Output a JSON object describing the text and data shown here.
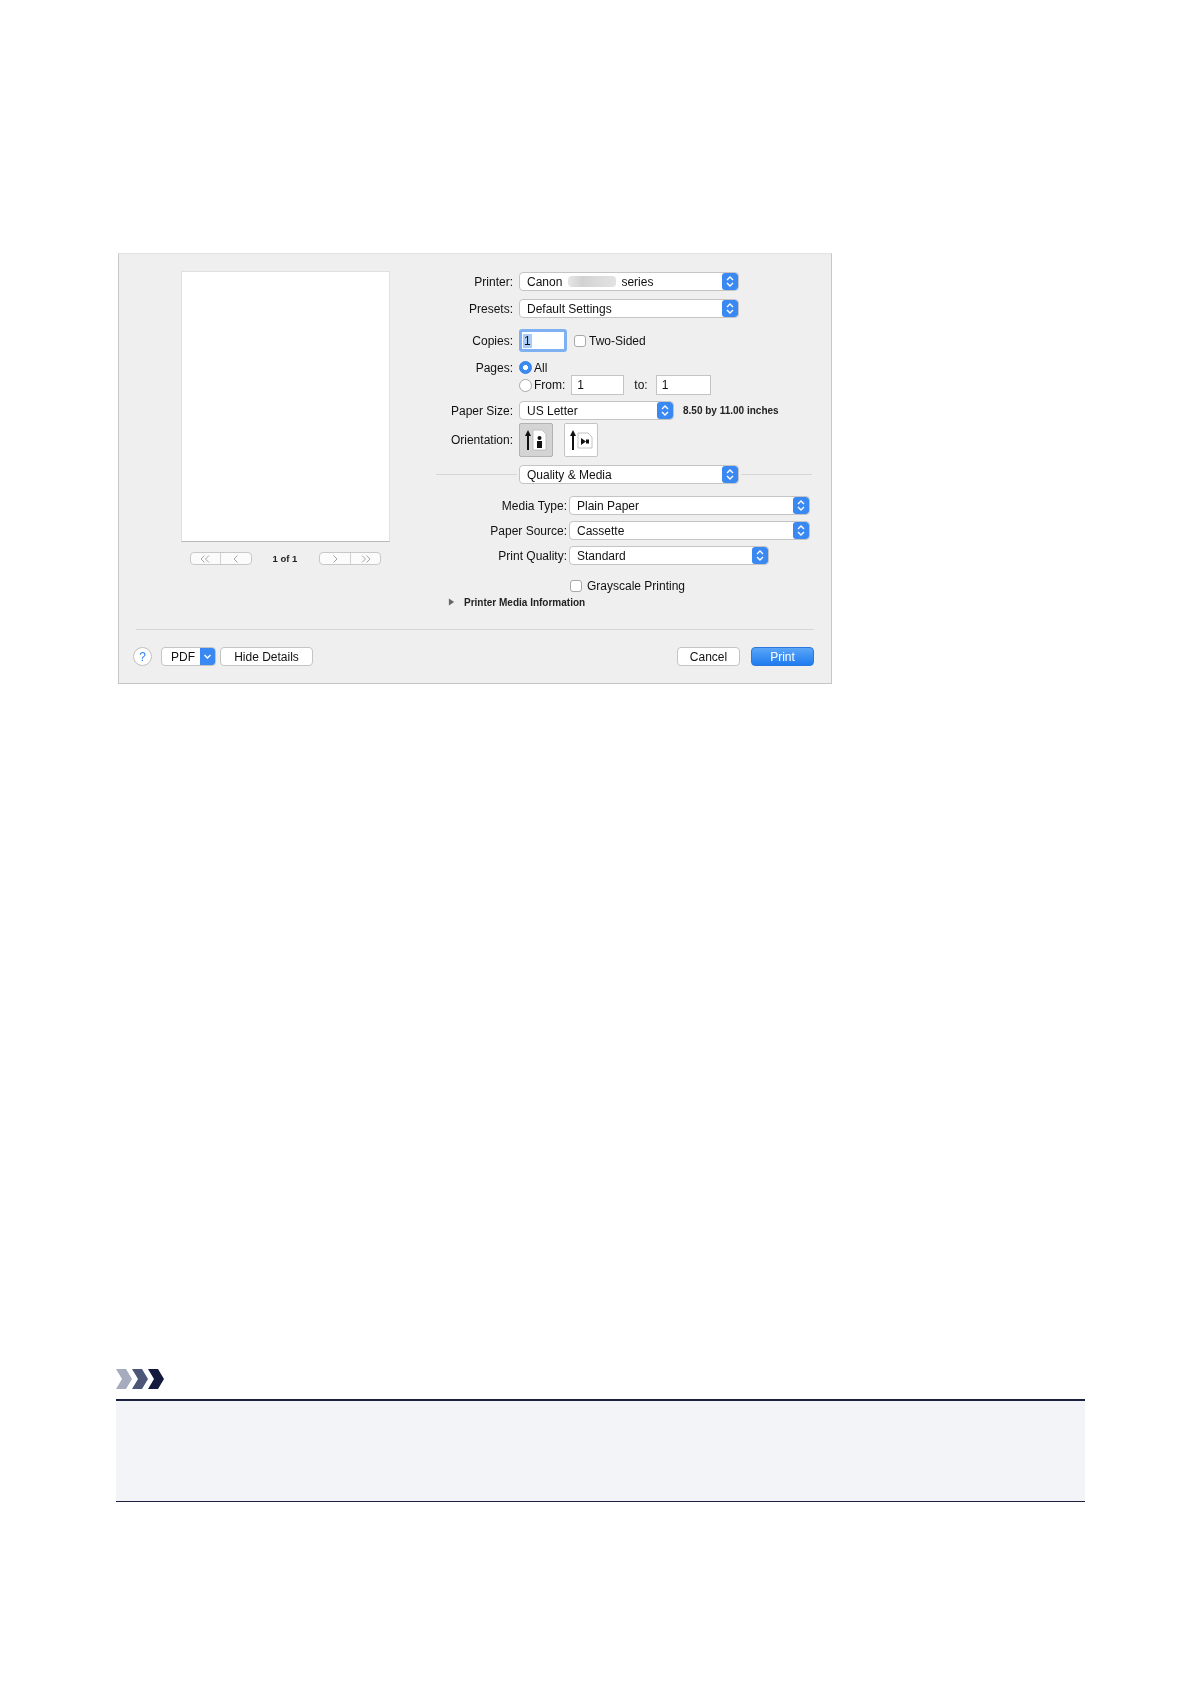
{
  "dialog": {
    "preview": {
      "page_label": "1 of 1"
    },
    "printer": {
      "label": "Printer:",
      "value": "Canon",
      "suffix": "series",
      "redacted": true
    },
    "presets": {
      "label": "Presets:",
      "value": "Default Settings"
    },
    "copies": {
      "label": "Copies:",
      "value": "1",
      "focused": true
    },
    "two_sided": {
      "label": "Two-Sided",
      "checked": false
    },
    "pages": {
      "label": "Pages:",
      "options": [
        {
          "label": "All",
          "selected": true
        },
        {
          "label": "From:",
          "selected": false
        }
      ],
      "from": "1",
      "to_label": "to:",
      "to": "1"
    },
    "paper_size": {
      "label": "Paper Size:",
      "value": "US Letter",
      "dimensions": "8.50 by 11.00 inches"
    },
    "orientation": {
      "label": "Orientation:",
      "options": [
        {
          "kind": "portrait",
          "selected": true
        },
        {
          "kind": "landscape",
          "selected": false
        }
      ]
    },
    "panel_menu": {
      "value": "Quality & Media"
    },
    "quality_settings": [
      {
        "label": "Media Type:",
        "value": "Plain Paper"
      },
      {
        "label": "Paper Source:",
        "value": "Cassette"
      },
      {
        "label": "Print Quality:",
        "value": "Standard"
      }
    ],
    "grayscale": {
      "label": "Grayscale Printing",
      "checked": false
    },
    "media_info": {
      "label": "Printer Media Information",
      "expanded": false
    },
    "buttons": {
      "help": "?",
      "pdf": "PDF",
      "hide_details": "Hide Details",
      "cancel": {
        "label": "Cancel",
        "default": false
      },
      "print": {
        "label": "Print",
        "default": true
      }
    }
  }
}
